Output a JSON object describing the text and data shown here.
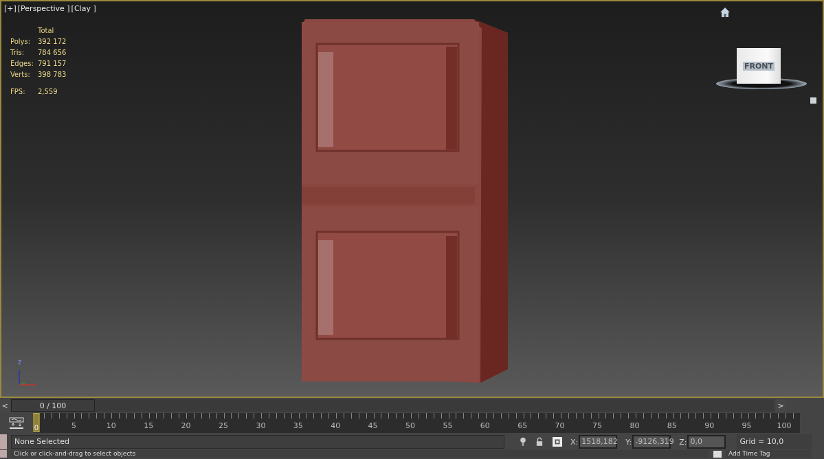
{
  "viewport": {
    "label_plus": "[+]",
    "label_view": "[Perspective ]",
    "label_shading": "[Clay ]",
    "stats": {
      "header": "Total",
      "rows": [
        {
          "label": "Polys:",
          "value": "392 172"
        },
        {
          "label": "Tris:",
          "value": "784 656"
        },
        {
          "label": "Edges:",
          "value": "791 157"
        },
        {
          "label": "Verts:",
          "value": "398 783"
        }
      ],
      "fps_label": "FPS:",
      "fps_value": "2,559"
    },
    "viewcube": {
      "face": "FRONT"
    },
    "axis": {
      "z": "z"
    }
  },
  "time_slider": {
    "prev": "<",
    "position": "0 / 100",
    "level": 0,
    "next": ">"
  },
  "timeline": {
    "ticks": [
      {
        "label": "0",
        "selected": true
      },
      {
        "label": "5",
        "selected": false
      },
      {
        "label": "10",
        "selected": false
      },
      {
        "label": "15",
        "selected": false
      },
      {
        "label": "20",
        "selected": false
      },
      {
        "label": "25",
        "selected": false
      },
      {
        "label": "30",
        "selected": false
      },
      {
        "label": "35",
        "selected": false
      },
      {
        "label": "40",
        "selected": false
      },
      {
        "label": "45",
        "selected": false
      },
      {
        "label": "50",
        "selected": false
      },
      {
        "label": "55",
        "selected": false
      },
      {
        "label": "60",
        "selected": false
      },
      {
        "label": "65",
        "selected": false
      },
      {
        "label": "70",
        "selected": false
      },
      {
        "label": "75",
        "selected": false
      },
      {
        "label": "80",
        "selected": false
      },
      {
        "label": "85",
        "selected": false
      },
      {
        "label": "90",
        "selected": false
      },
      {
        "label": "95",
        "selected": false
      },
      {
        "label": "100",
        "selected": false
      }
    ]
  },
  "status_bar": {
    "selection": "None Selected",
    "x_label": "X:",
    "x_value": "1518,182",
    "y_label": "Y:",
    "y_value": "-9126,319",
    "z_label": "Z:",
    "z_value": "0,0",
    "grid": "Grid = 10,0",
    "prompt": "Click or click-and-drag to select objects",
    "time_tag": "Add Time Tag"
  }
}
